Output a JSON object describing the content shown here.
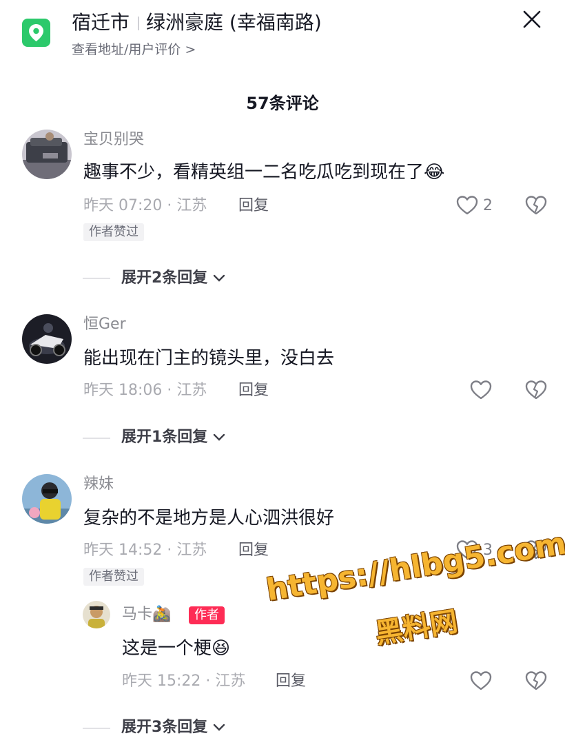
{
  "header": {
    "city": "宿迁市",
    "place": "绿洲豪庭 (幸福南路)",
    "subtitle": "查看地址/用户评价 >",
    "location_icon": "map-pin-icon",
    "close_icon": "close-icon"
  },
  "comments_title": "57条评论",
  "comments": [
    {
      "user": "宝贝别哭",
      "text": "趣事不少，看精英组一二名吃瓜吃到现在了",
      "emoji": "😂",
      "time": "昨天 07:20 · 江苏",
      "reply_label": "回复",
      "likes": "2",
      "tag": "作者赞过",
      "expand": "展开2条回复"
    },
    {
      "user": "恒Ger",
      "text": "能出现在门主的镜头里，没白去",
      "time": "昨天 18:06 · 江苏",
      "reply_label": "回复",
      "likes": "",
      "expand": "展开1条回复"
    },
    {
      "user": "辣妹",
      "text": "复杂的不是地方是人心泗洪很好",
      "time": "昨天 14:52 · 江苏",
      "reply_label": "回复",
      "likes": "3",
      "tag": "作者赞过",
      "reply": {
        "user": "马卡🚵",
        "author_tag": "作者",
        "text": "这是一个梗",
        "emoji": "😆",
        "time": "昨天 15:22 · 江苏",
        "reply_label": "回复"
      },
      "expand": "展开3条回复"
    }
  ],
  "watermark": {
    "url": "https://hlbg5.com",
    "site": "黑料网"
  },
  "colors": {
    "accent_green": "#2cc96b",
    "author_red": "#fe2c55",
    "watermark_orange": "#f6b531"
  }
}
